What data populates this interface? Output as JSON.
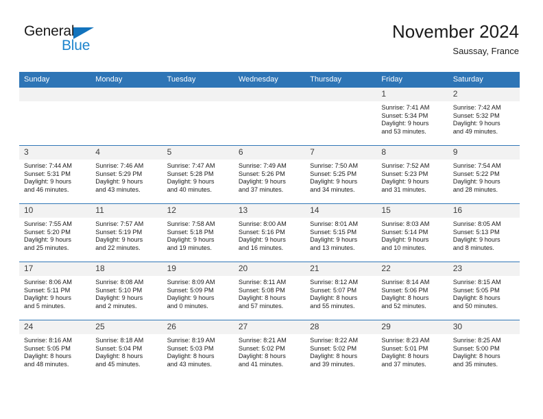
{
  "brand": {
    "name_part1": "General",
    "name_part2": "Blue",
    "triangle_color": "#1273bd",
    "blue_color": "#1d84cd"
  },
  "header": {
    "title": "November 2024",
    "subtitle": "Saussay, France"
  },
  "theme": {
    "header_bg": "#2e75b6",
    "daynum_bg": "#f2f2f2",
    "grid_line": "#2e75b6"
  },
  "weekdays": [
    "Sunday",
    "Monday",
    "Tuesday",
    "Wednesday",
    "Thursday",
    "Friday",
    "Saturday"
  ],
  "weeks": [
    [
      {
        "day": "",
        "blank": true
      },
      {
        "day": "",
        "blank": true
      },
      {
        "day": "",
        "blank": true
      },
      {
        "day": "",
        "blank": true
      },
      {
        "day": "",
        "blank": true
      },
      {
        "day": "1",
        "sunrise": "Sunrise: 7:41 AM",
        "sunset": "Sunset: 5:34 PM",
        "daylight1": "Daylight: 9 hours",
        "daylight2": "and 53 minutes."
      },
      {
        "day": "2",
        "sunrise": "Sunrise: 7:42 AM",
        "sunset": "Sunset: 5:32 PM",
        "daylight1": "Daylight: 9 hours",
        "daylight2": "and 49 minutes."
      }
    ],
    [
      {
        "day": "3",
        "sunrise": "Sunrise: 7:44 AM",
        "sunset": "Sunset: 5:31 PM",
        "daylight1": "Daylight: 9 hours",
        "daylight2": "and 46 minutes."
      },
      {
        "day": "4",
        "sunrise": "Sunrise: 7:46 AM",
        "sunset": "Sunset: 5:29 PM",
        "daylight1": "Daylight: 9 hours",
        "daylight2": "and 43 minutes."
      },
      {
        "day": "5",
        "sunrise": "Sunrise: 7:47 AM",
        "sunset": "Sunset: 5:28 PM",
        "daylight1": "Daylight: 9 hours",
        "daylight2": "and 40 minutes."
      },
      {
        "day": "6",
        "sunrise": "Sunrise: 7:49 AM",
        "sunset": "Sunset: 5:26 PM",
        "daylight1": "Daylight: 9 hours",
        "daylight2": "and 37 minutes."
      },
      {
        "day": "7",
        "sunrise": "Sunrise: 7:50 AM",
        "sunset": "Sunset: 5:25 PM",
        "daylight1": "Daylight: 9 hours",
        "daylight2": "and 34 minutes."
      },
      {
        "day": "8",
        "sunrise": "Sunrise: 7:52 AM",
        "sunset": "Sunset: 5:23 PM",
        "daylight1": "Daylight: 9 hours",
        "daylight2": "and 31 minutes."
      },
      {
        "day": "9",
        "sunrise": "Sunrise: 7:54 AM",
        "sunset": "Sunset: 5:22 PM",
        "daylight1": "Daylight: 9 hours",
        "daylight2": "and 28 minutes."
      }
    ],
    [
      {
        "day": "10",
        "sunrise": "Sunrise: 7:55 AM",
        "sunset": "Sunset: 5:20 PM",
        "daylight1": "Daylight: 9 hours",
        "daylight2": "and 25 minutes."
      },
      {
        "day": "11",
        "sunrise": "Sunrise: 7:57 AM",
        "sunset": "Sunset: 5:19 PM",
        "daylight1": "Daylight: 9 hours",
        "daylight2": "and 22 minutes."
      },
      {
        "day": "12",
        "sunrise": "Sunrise: 7:58 AM",
        "sunset": "Sunset: 5:18 PM",
        "daylight1": "Daylight: 9 hours",
        "daylight2": "and 19 minutes."
      },
      {
        "day": "13",
        "sunrise": "Sunrise: 8:00 AM",
        "sunset": "Sunset: 5:16 PM",
        "daylight1": "Daylight: 9 hours",
        "daylight2": "and 16 minutes."
      },
      {
        "day": "14",
        "sunrise": "Sunrise: 8:01 AM",
        "sunset": "Sunset: 5:15 PM",
        "daylight1": "Daylight: 9 hours",
        "daylight2": "and 13 minutes."
      },
      {
        "day": "15",
        "sunrise": "Sunrise: 8:03 AM",
        "sunset": "Sunset: 5:14 PM",
        "daylight1": "Daylight: 9 hours",
        "daylight2": "and 10 minutes."
      },
      {
        "day": "16",
        "sunrise": "Sunrise: 8:05 AM",
        "sunset": "Sunset: 5:13 PM",
        "daylight1": "Daylight: 9 hours",
        "daylight2": "and 8 minutes."
      }
    ],
    [
      {
        "day": "17",
        "sunrise": "Sunrise: 8:06 AM",
        "sunset": "Sunset: 5:11 PM",
        "daylight1": "Daylight: 9 hours",
        "daylight2": "and 5 minutes."
      },
      {
        "day": "18",
        "sunrise": "Sunrise: 8:08 AM",
        "sunset": "Sunset: 5:10 PM",
        "daylight1": "Daylight: 9 hours",
        "daylight2": "and 2 minutes."
      },
      {
        "day": "19",
        "sunrise": "Sunrise: 8:09 AM",
        "sunset": "Sunset: 5:09 PM",
        "daylight1": "Daylight: 9 hours",
        "daylight2": "and 0 minutes."
      },
      {
        "day": "20",
        "sunrise": "Sunrise: 8:11 AM",
        "sunset": "Sunset: 5:08 PM",
        "daylight1": "Daylight: 8 hours",
        "daylight2": "and 57 minutes."
      },
      {
        "day": "21",
        "sunrise": "Sunrise: 8:12 AM",
        "sunset": "Sunset: 5:07 PM",
        "daylight1": "Daylight: 8 hours",
        "daylight2": "and 55 minutes."
      },
      {
        "day": "22",
        "sunrise": "Sunrise: 8:14 AM",
        "sunset": "Sunset: 5:06 PM",
        "daylight1": "Daylight: 8 hours",
        "daylight2": "and 52 minutes."
      },
      {
        "day": "23",
        "sunrise": "Sunrise: 8:15 AM",
        "sunset": "Sunset: 5:05 PM",
        "daylight1": "Daylight: 8 hours",
        "daylight2": "and 50 minutes."
      }
    ],
    [
      {
        "day": "24",
        "sunrise": "Sunrise: 8:16 AM",
        "sunset": "Sunset: 5:05 PM",
        "daylight1": "Daylight: 8 hours",
        "daylight2": "and 48 minutes."
      },
      {
        "day": "25",
        "sunrise": "Sunrise: 8:18 AM",
        "sunset": "Sunset: 5:04 PM",
        "daylight1": "Daylight: 8 hours",
        "daylight2": "and 45 minutes."
      },
      {
        "day": "26",
        "sunrise": "Sunrise: 8:19 AM",
        "sunset": "Sunset: 5:03 PM",
        "daylight1": "Daylight: 8 hours",
        "daylight2": "and 43 minutes."
      },
      {
        "day": "27",
        "sunrise": "Sunrise: 8:21 AM",
        "sunset": "Sunset: 5:02 PM",
        "daylight1": "Daylight: 8 hours",
        "daylight2": "and 41 minutes."
      },
      {
        "day": "28",
        "sunrise": "Sunrise: 8:22 AM",
        "sunset": "Sunset: 5:02 PM",
        "daylight1": "Daylight: 8 hours",
        "daylight2": "and 39 minutes."
      },
      {
        "day": "29",
        "sunrise": "Sunrise: 8:23 AM",
        "sunset": "Sunset: 5:01 PM",
        "daylight1": "Daylight: 8 hours",
        "daylight2": "and 37 minutes."
      },
      {
        "day": "30",
        "sunrise": "Sunrise: 8:25 AM",
        "sunset": "Sunset: 5:00 PM",
        "daylight1": "Daylight: 8 hours",
        "daylight2": "and 35 minutes."
      }
    ]
  ]
}
